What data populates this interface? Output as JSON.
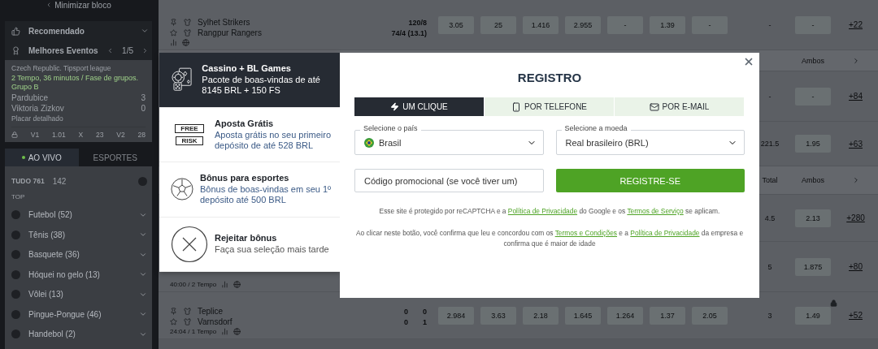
{
  "sidebar": {
    "minimize": "Minimizar bloco",
    "recommended": "Recomendado",
    "best_events": {
      "label": "Melhores Eventos",
      "pager": "1/5"
    },
    "featured": {
      "league": "Czech Republic. Tipsport league",
      "status": "2 Tempo, 36 minutos / Fase de grupos. Grupo B",
      "teams": [
        {
          "name": "Pardubice",
          "score": "3"
        },
        {
          "name": "Viktoria Zizkov",
          "score": "0"
        }
      ],
      "details": "Placar detalhado",
      "locked": true,
      "odds": [
        {
          "label": "V1",
          "value": "1.01"
        },
        {
          "label": "X",
          "value": "23"
        },
        {
          "label": "V2",
          "value": "28"
        }
      ]
    },
    "tabs": [
      {
        "label": "AO VIVO",
        "selected": true
      },
      {
        "label": "ESPORTES",
        "selected": false
      }
    ],
    "filter": {
      "label": "TUDO 761",
      "count": "142"
    },
    "group": "TOP",
    "sports": [
      {
        "name": "Futebol (52)"
      },
      {
        "name": "Tênis (38)"
      },
      {
        "name": "Basquete (36)"
      },
      {
        "name": "Hóquei no gelo (13)"
      },
      {
        "name": "Vôlei (13)"
      },
      {
        "name": "Pingue-Pongue (46)"
      },
      {
        "name": "Handebol (2)"
      }
    ]
  },
  "events": [
    {
      "kind": "match",
      "teams": [
        {
          "name": "Sylhet Strikers",
          "score": "120/8"
        },
        {
          "name": "Rangpur Rangers",
          "score": "74/4 (13.1)"
        }
      ],
      "odds": [
        "3.05",
        "25",
        "1.416",
        "2.955",
        "-",
        "1.39",
        "-"
      ],
      "total": "-",
      "ambos": "-",
      "more": "+22",
      "locked": false
    },
    {
      "kind": "header",
      "ambos": "Ambos"
    },
    {
      "kind": "match",
      "total": "-",
      "ambos": "-",
      "more": "+84",
      "locked": false
    },
    {
      "kind": "match",
      "total": "221.5",
      "ambos": "1.95",
      "more": "+63",
      "locked": false
    },
    {
      "kind": "header",
      "total": "Total",
      "ambos": "Ambos"
    },
    {
      "kind": "match",
      "total": "4.5",
      "ambos": "2.13",
      "more": "+280",
      "locked": false
    },
    {
      "kind": "match",
      "time": "40:00 / 2 Tempo",
      "total": "5",
      "ambos": "1.875",
      "more": "+80",
      "locked": false
    },
    {
      "kind": "match",
      "teams": [
        {
          "name": "Teplice",
          "score": "0",
          "score2": "0"
        },
        {
          "name": "Varnsdorf",
          "score": "0",
          "score2": "1"
        }
      ],
      "time": "24:04 / 1 Tempo",
      "odds": [
        "2.984",
        "3.63",
        "2.18",
        "1.645",
        "1.264",
        "1.37",
        "2.05"
      ],
      "total": "3",
      "ambos": "1.49",
      "more": "+52",
      "locked": true
    }
  ],
  "bonuses": [
    {
      "kind": "casino",
      "title": "Cassino + BL Games",
      "text": "Pacote de boas-vindas de até 8145 BRL + 150 FS",
      "selected": true
    },
    {
      "kind": "freebet",
      "title": "Aposta Grátis",
      "text": "Aposta grátis no seu primeiro depósito de até 528 BRL",
      "badge_lines": [
        "FREE",
        "RISK"
      ],
      "selected": false
    },
    {
      "kind": "sports",
      "title": "Bônus para esportes",
      "text": "Bônus de boas-vindas em seu 1º depósito até 500 BRL",
      "selected": false
    },
    {
      "kind": "reject",
      "title": "Rejeitar bônus",
      "text": "Faça sua seleção mais tarde",
      "selected": false
    }
  ],
  "registration": {
    "title": "REGISTRO",
    "tabs": [
      {
        "kind": "click",
        "label": "UM CLIQUE",
        "selected": true
      },
      {
        "kind": "phone",
        "label": "POR TELEFONE",
        "selected": false
      },
      {
        "kind": "email",
        "label": "POR E-MAIL",
        "selected": false
      }
    ],
    "country": {
      "label": "Selecione o país",
      "value": "Brasil"
    },
    "currency": {
      "label": "Selecione a moeda",
      "value": "Real brasileiro (BRL)"
    },
    "promo": {
      "placeholder": "Código promocional (se você tiver um)"
    },
    "submit": "REGISTRE-SE",
    "notes": [
      [
        {
          "text": "Esse site é protegido por reCAPTCHA e a "
        },
        {
          "text": "Política de Privacidade",
          "link": true
        },
        {
          "text": " do Google e os "
        },
        {
          "text": "Termos de Serviço",
          "link": true
        },
        {
          "text": " se aplicam."
        }
      ],
      [
        {
          "text": "Ao clicar neste botão, você confirma que leu e concordou com os "
        },
        {
          "text": "Termos e Condições",
          "link": true
        },
        {
          "text": " e a "
        },
        {
          "text": "Política de Privacidade",
          "link": true
        },
        {
          "text": " da empresa e confirma que é maior de idade"
        }
      ]
    ]
  }
}
